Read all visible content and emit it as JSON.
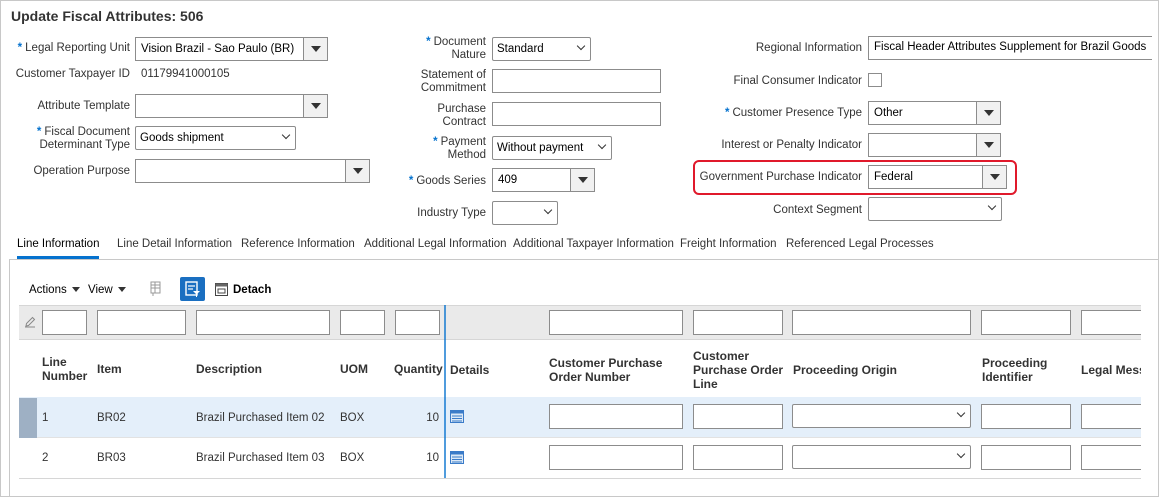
{
  "page": {
    "title": "Update Fiscal Attributes: 506"
  },
  "fields": {
    "legal_reporting_unit": {
      "label": "Legal Reporting Unit",
      "value": "Vision Brazil - Sao Paulo (BR)"
    },
    "customer_taxpayer_id": {
      "label": "Customer Taxpayer ID",
      "value": "01179941000105"
    },
    "attribute_template": {
      "label": "Attribute Template",
      "value": ""
    },
    "fiscal_doc_determinant": {
      "label_line1": "Fiscal Document",
      "label_line2": "Determinant Type",
      "value": "Goods shipment"
    },
    "operation_purpose": {
      "label": "Operation Purpose",
      "value": ""
    },
    "document_nature": {
      "label_line1": "Document",
      "label_line2": "Nature",
      "value": "Standard"
    },
    "statement_of_commitment": {
      "label_line1": "Statement of",
      "label_line2": "Commitment",
      "value": ""
    },
    "purchase_contract": {
      "label_line1": "Purchase",
      "label_line2": "Contract",
      "value": ""
    },
    "payment_method": {
      "label_line1": "Payment",
      "label_line2": "Method",
      "value": "Without payment"
    },
    "goods_series": {
      "label": "Goods Series",
      "value": "409"
    },
    "industry_type": {
      "label": "Industry Type",
      "value": ""
    },
    "regional_information": {
      "label": "Regional Information",
      "value": "Fiscal Header Attributes Supplement for Brazil Goods"
    },
    "final_consumer_indicator": {
      "label": "Final Consumer Indicator",
      "checked": false
    },
    "customer_presence_type": {
      "label": "Customer Presence Type",
      "value": "Other"
    },
    "interest_or_penalty": {
      "label": "Interest or Penalty Indicator",
      "value": ""
    },
    "government_purchase": {
      "label": "Government Purchase Indicator",
      "value": "Federal"
    },
    "context_segment": {
      "label": "Context Segment",
      "value": ""
    }
  },
  "tabs": [
    {
      "label": "Line Information",
      "active": true
    },
    {
      "label": "Line Detail Information"
    },
    {
      "label": "Reference Information"
    },
    {
      "label": "Additional Legal Information"
    },
    {
      "label": "Additional Taxpayer Information"
    },
    {
      "label": "Freight Information"
    },
    {
      "label": "Referenced Legal Processes"
    }
  ],
  "toolbar": {
    "actions": "Actions",
    "view": "View",
    "detach": "Detach"
  },
  "table": {
    "columns": {
      "line_number_1": "Line",
      "line_number_2": "Number",
      "item": "Item",
      "description": "Description",
      "uom": "UOM",
      "quantity": "Quantity",
      "details": "Details",
      "cpo_number_1": "Customer Purchase",
      "cpo_number_2": "Order Number",
      "cpo_line_1": "Customer",
      "cpo_line_2": "Purchase Order",
      "cpo_line_3": "Line",
      "proceeding_origin": "Proceeding Origin",
      "proceeding_id_1": "Proceeding",
      "proceeding_id_2": "Identifier",
      "legal_message": "Legal Mess"
    },
    "rows": [
      {
        "line": "1",
        "item": "BR02",
        "description": "Brazil Purchased Item 02",
        "uom": "BOX",
        "quantity": "10"
      },
      {
        "line": "2",
        "item": "BR03",
        "description": "Brazil Purchased Item 03",
        "uom": "BOX",
        "quantity": "10"
      }
    ]
  },
  "colors": {
    "required": "#0572ce",
    "highlight": "#e0192b",
    "selected_row": "#e4effa"
  }
}
